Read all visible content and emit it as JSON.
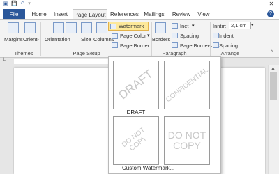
{
  "tabs": [
    "File",
    "Home",
    "Insert",
    "Page Layout",
    "References",
    "Mailings",
    "Review",
    "View"
  ],
  "ribbon": {
    "themes": {
      "label": "Themes"
    },
    "page_setup": {
      "margins": "Margins",
      "orientation_short": "Orient-",
      "orientation": "Orientation",
      "size": "Size",
      "columns": "Columns",
      "label": "Page Setup"
    },
    "background": {
      "watermark": "Watermark",
      "page_color": "Page Color",
      "page_border": "Page Border"
    },
    "paragraph": {
      "borders": "Borders",
      "indent": "Inet",
      "spacing": "Spacing",
      "page_borders": "Page Borders",
      "label": "Paragraph"
    },
    "arrange": {
      "indent_left_label": "Inntır:",
      "indent_left_value": "2,1 cm",
      "indent": "Indent",
      "spacing": "Spacing",
      "label": "Arrange"
    }
  },
  "dropdown": {
    "items": [
      {
        "text": "DRAFT",
        "caption": "DRAFT"
      },
      {
        "text": "CONFIDENTIAL",
        "caption": ""
      },
      {
        "text": "DO NOT COPY",
        "caption": ""
      },
      {
        "text": "DO NOT\nCOPY",
        "caption": ""
      }
    ],
    "custom": "Custom Watermark..."
  },
  "colors": {
    "accent": "#2b579a",
    "highlight": "#fde89a",
    "watermark_text": "#c7c7c7"
  }
}
